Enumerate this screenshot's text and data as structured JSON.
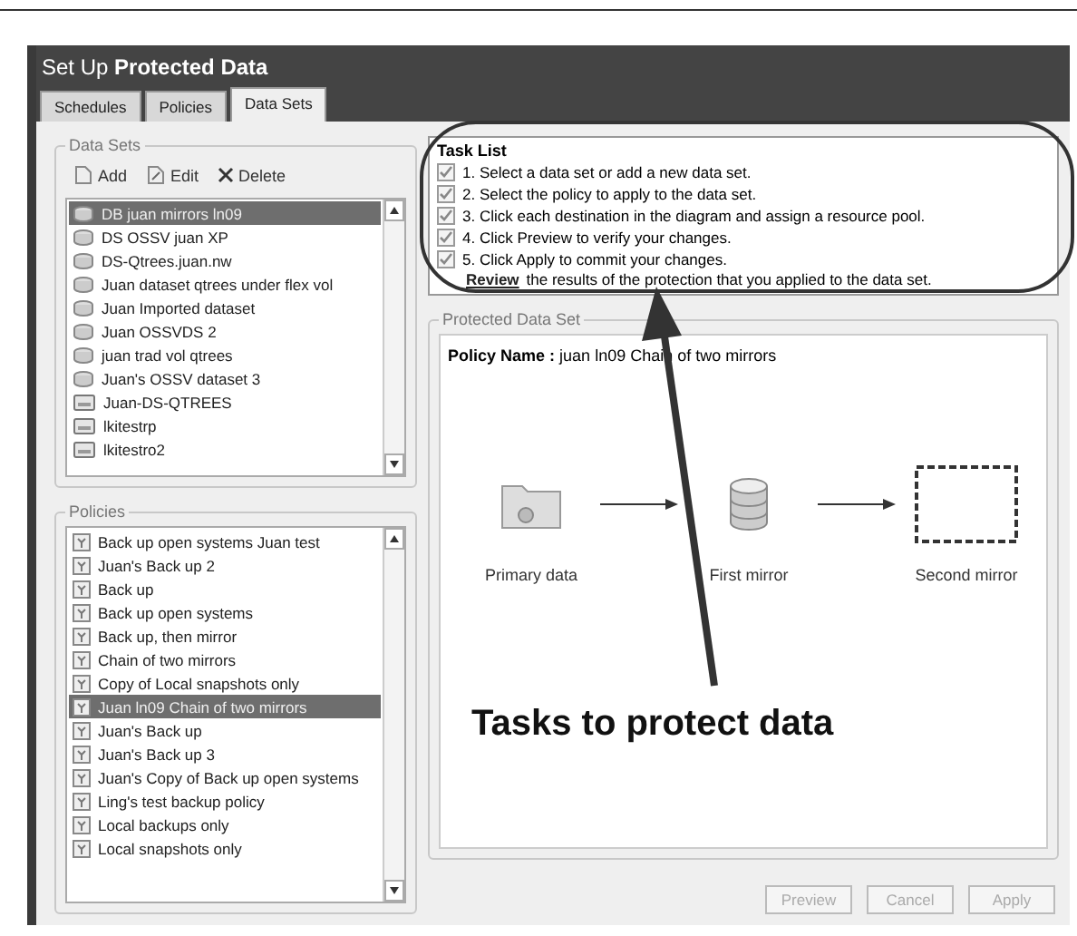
{
  "window": {
    "title_prefix": "Set Up",
    "title_bold": "Protected Data"
  },
  "tabs": [
    {
      "label": "Schedules",
      "selected": false
    },
    {
      "label": "Policies",
      "selected": false
    },
    {
      "label": "Data Sets",
      "selected": true
    }
  ],
  "data_sets": {
    "title": "Data Sets",
    "toolbar": [
      {
        "label": "Add",
        "kind": "add"
      },
      {
        "label": "Edit",
        "kind": "edit"
      },
      {
        "label": "Delete",
        "kind": "delete"
      }
    ],
    "items": [
      {
        "label": "DB juan mirrors ln09",
        "kind": "dataset",
        "selected": true
      },
      {
        "label": "DS OSSV juan XP",
        "kind": "dataset",
        "selected": false
      },
      {
        "label": "DS-Qtrees.juan.nw",
        "kind": "dataset",
        "selected": false
      },
      {
        "label": "Juan dataset qtrees under flex vol",
        "kind": "dataset",
        "selected": false
      },
      {
        "label": "Juan Imported dataset",
        "kind": "dataset",
        "selected": false
      },
      {
        "label": "Juan OSSVDS 2",
        "kind": "dataset",
        "selected": false
      },
      {
        "label": "juan trad vol qtrees",
        "kind": "dataset",
        "selected": false
      },
      {
        "label": "Juan's OSSV dataset 3",
        "kind": "dataset",
        "selected": false
      },
      {
        "label": "Juan-DS-QTREES",
        "kind": "tray",
        "selected": false
      },
      {
        "label": "lkitestrp",
        "kind": "tray",
        "selected": false
      },
      {
        "label": "lkitestro2",
        "kind": "tray",
        "selected": false
      }
    ]
  },
  "policies": {
    "title": "Policies",
    "items": [
      {
        "label": "Back up open systems Juan test",
        "selected": false
      },
      {
        "label": "Juan's  Back up 2",
        "selected": false
      },
      {
        "label": "Back up",
        "selected": false
      },
      {
        "label": "Back up open systems",
        "selected": false
      },
      {
        "label": "Back up, then mirror",
        "selected": false
      },
      {
        "label": "Chain of two mirrors",
        "selected": false
      },
      {
        "label": "Copy of Local snapshots only",
        "selected": false
      },
      {
        "label": "Juan ln09 Chain of two mirrors",
        "selected": true
      },
      {
        "label": "Juan's  Back up",
        "selected": false
      },
      {
        "label": "Juan's  Back up 3",
        "selected": false
      },
      {
        "label": "Juan's Copy of Back up open systems",
        "selected": false
      },
      {
        "label": "Ling's test backup policy",
        "selected": false
      },
      {
        "label": "Local backups only",
        "selected": false
      },
      {
        "label": "Local snapshots only",
        "selected": false
      }
    ]
  },
  "task_list": {
    "title": "Task List",
    "steps": [
      {
        "text": "1. Select a data set or add a new data set.",
        "checked": true
      },
      {
        "text": "2. Select the policy to apply to the data set.",
        "checked": true
      },
      {
        "text": "3. Click each destination in the diagram and assign a resource pool.",
        "checked": true
      },
      {
        "text": "4. Click Preview to verify your changes.",
        "checked": true
      },
      {
        "text": "5. Click Apply to commit your changes.",
        "checked": true
      }
    ],
    "review_link": "Review",
    "review_text": "the results of the protection that you applied to the data set."
  },
  "protected_data_set": {
    "title": "Protected Data Set",
    "policy_label": "Policy Name :",
    "policy_value": "juan ln09 Chain of two mirrors",
    "nodes": [
      {
        "label": "Primary data",
        "kind": "folder"
      },
      {
        "label": "First mirror",
        "kind": "database"
      },
      {
        "label": "Second mirror",
        "kind": "empty"
      }
    ]
  },
  "buttons": [
    {
      "label": "Preview",
      "disabled": true
    },
    {
      "label": "Cancel",
      "disabled": true
    },
    {
      "label": "Apply",
      "disabled": true
    }
  ],
  "annotation": {
    "text": "Tasks to protect data"
  }
}
